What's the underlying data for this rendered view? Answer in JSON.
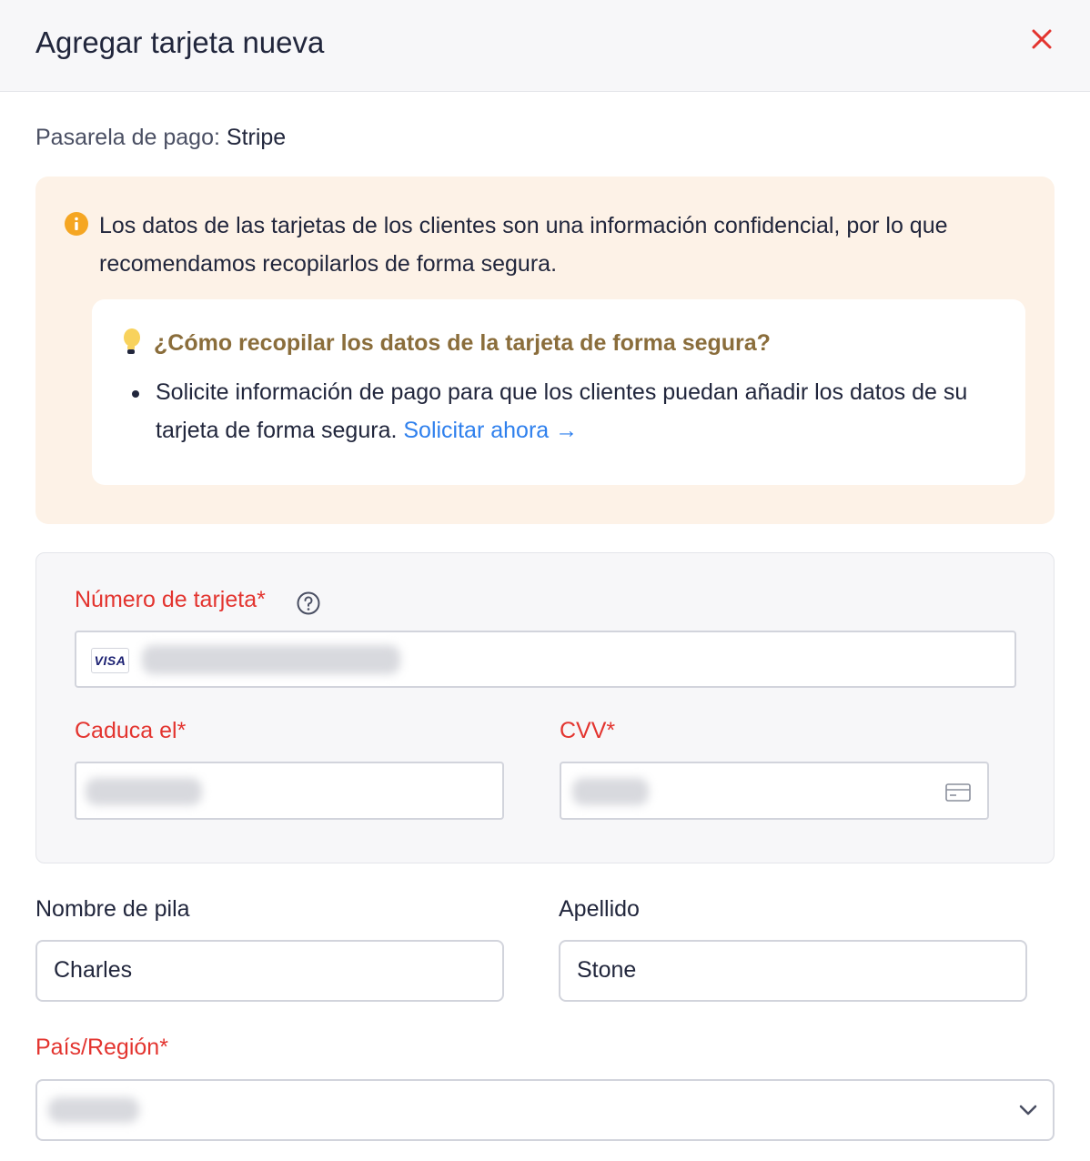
{
  "header": {
    "title": "Agregar tarjeta nueva",
    "close_icon": "close-icon",
    "close_color": "#e3342f"
  },
  "gateway": {
    "label": "Pasarela de pago:",
    "value": "Stripe"
  },
  "notice": {
    "icon": "info-icon",
    "text": "Los datos de las tarjetas de los clientes son una información confidencial, por lo que recomendamos recopilarlos de forma segura.",
    "tip": {
      "icon": "lightbulb-icon",
      "title": "¿Cómo recopilar los datos de la tarjeta de forma segura?",
      "text": "Solicite información de pago para que los clientes puedan añadir los datos de su tarjeta de forma segura.",
      "link": "Solicitar ahora →"
    }
  },
  "card": {
    "number_label": "Número de tarjeta*",
    "brand": "VISA",
    "expiry_label": "Caduca el*",
    "cvv_label": "CVV*"
  },
  "name": {
    "first_label": "Nombre de pila",
    "first_value": "Charles",
    "last_label": "Apellido",
    "last_value": "Stone"
  },
  "country": {
    "label": "País/Región*"
  },
  "colors": {
    "required": "#e3342f",
    "link": "#2f80ed",
    "notice_bg": "#fdf2e7",
    "tip_title": "#8a6d3b",
    "info_icon": "#f5a623"
  }
}
